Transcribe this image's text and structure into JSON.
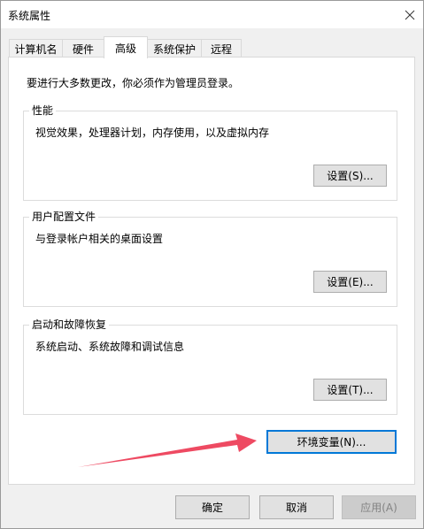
{
  "window": {
    "title": "系统属性"
  },
  "tabs": [
    {
      "label": "计算机名",
      "active": false
    },
    {
      "label": "硬件",
      "active": false
    },
    {
      "label": "高级",
      "active": true
    },
    {
      "label": "系统保护",
      "active": false
    },
    {
      "label": "远程",
      "active": false
    }
  ],
  "panel": {
    "notice": "要进行大多数更改，你必须作为管理员登录。",
    "groups": {
      "performance": {
        "title": "性能",
        "description": "视觉效果，处理器计划，内存使用，以及虚拟内存",
        "button": "设置(S)..."
      },
      "user_profiles": {
        "title": "用户配置文件",
        "description": "与登录帐户相关的桌面设置",
        "button": "设置(E)..."
      },
      "startup_recovery": {
        "title": "启动和故障恢复",
        "description": "系统启动、系统故障和调试信息",
        "button": "设置(T)..."
      }
    },
    "env_button": "环境变量(N)..."
  },
  "footer": {
    "ok": "确定",
    "cancel": "取消",
    "apply": "应用(A)"
  },
  "colors": {
    "arrow": "#ee4a62",
    "focus_border": "#0078d7",
    "button_face": "#e1e1e1"
  },
  "icons": {
    "close": "close-icon"
  }
}
